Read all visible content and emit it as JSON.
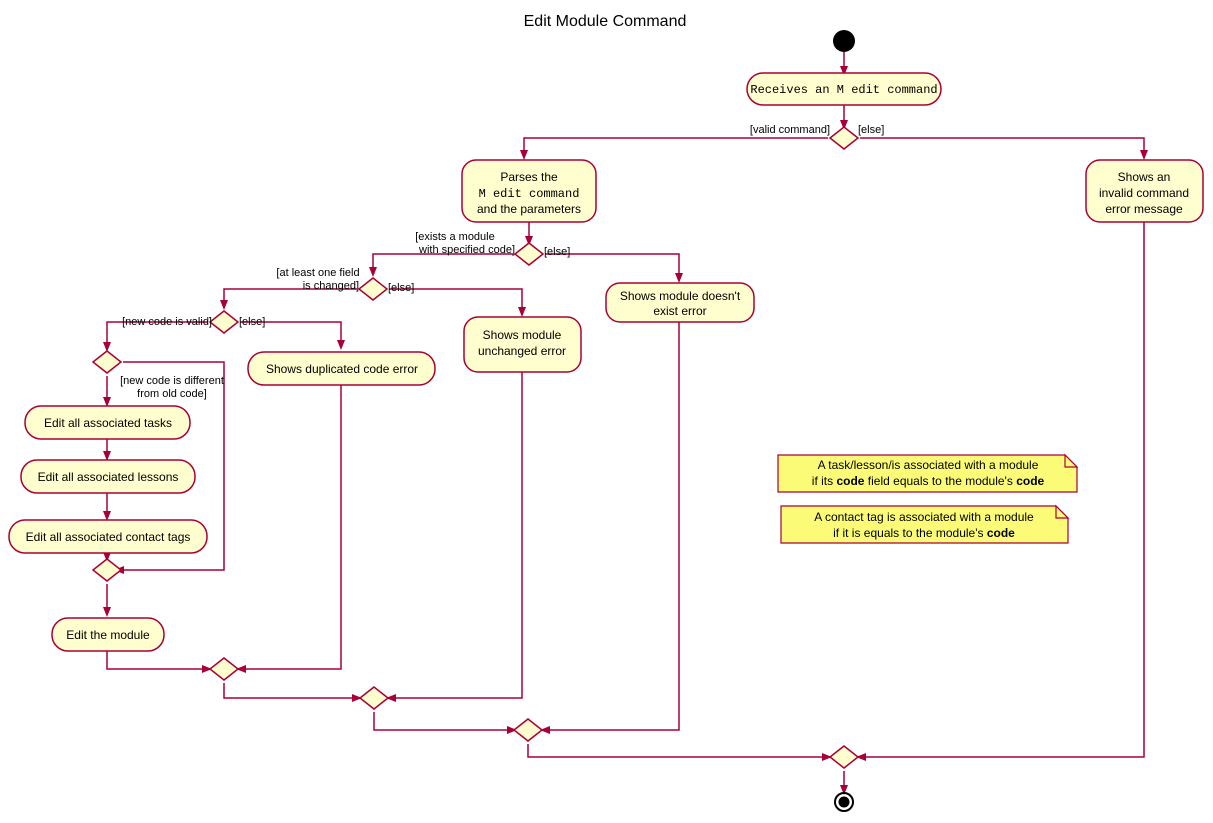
{
  "diagram": {
    "title": "Edit Module Command",
    "type": "uml-activity-diagram",
    "colors": {
      "node_fill": "#FEFECE",
      "node_stroke": "#A80036",
      "note_fill": "#FBFB77",
      "flow_stroke": "#A80036",
      "text": "#000000",
      "background": "#FFFFFF"
    },
    "nodes": {
      "start": {
        "name": "start-node"
      },
      "receives": {
        "lines": [
          "Receives an M edit command"
        ],
        "label": "Receives an M edit command"
      },
      "parses": {
        "line1": "Parses the",
        "line2": "M edit command",
        "line3": "and the parameters",
        "label": "Parses the M edit command and the parameters"
      },
      "invalid_command": {
        "line1": "Shows an",
        "line2": "invalid command",
        "line3": "error message",
        "label": "Shows an invalid command error message"
      },
      "module_not_exist": {
        "line1": "Shows module doesn't",
        "line2": "exist error",
        "label": "Shows module doesn't exist error"
      },
      "module_unchanged": {
        "line1": "Shows module",
        "line2": "unchanged error",
        "label": "Shows module unchanged error"
      },
      "duplicated_code": {
        "line1": "Shows duplicated code error",
        "label": "Shows duplicated code error"
      },
      "edit_tasks": {
        "label": "Edit all associated tasks"
      },
      "edit_lessons": {
        "label": "Edit all associated lessons"
      },
      "edit_contact_tags": {
        "label": "Edit all associated contact tags"
      },
      "edit_module": {
        "label": "Edit the module"
      },
      "end": {
        "name": "end-node"
      }
    },
    "guards": {
      "valid_command": "[valid command]",
      "else_1": "[else]",
      "exists_module_l1": "[exists a module",
      "exists_module_l2": "with specified code]",
      "else_2": "[else]",
      "at_least_one_field_l1": "[at least one field",
      "at_least_one_field_l2": "is changed]",
      "else_3": "[else]",
      "new_code_valid": "[new code is valid]",
      "else_4": "[else]",
      "new_code_different_l1": "[new code is different",
      "new_code_different_l2": "from old code]"
    },
    "notes": [
      {
        "id": "note-task-lesson",
        "line1_pre": "A task/lesson/is associated with a module",
        "line2_a": "if its ",
        "line2_bold1": "code",
        "line2_b": " field equals to the module's ",
        "line2_bold2": "code",
        "full": "A task/lesson/is associated with a module if its code field equals to the module's code"
      },
      {
        "id": "note-contact-tag",
        "line1_pre": "A contact tag is associated with a module",
        "line2_a": "if it is equals to the module's ",
        "line2_bold1": "code",
        "line2_b": "",
        "line2_bold2": "",
        "full": "A contact tag is associated with a module if it is equals to the module's code"
      }
    ]
  }
}
